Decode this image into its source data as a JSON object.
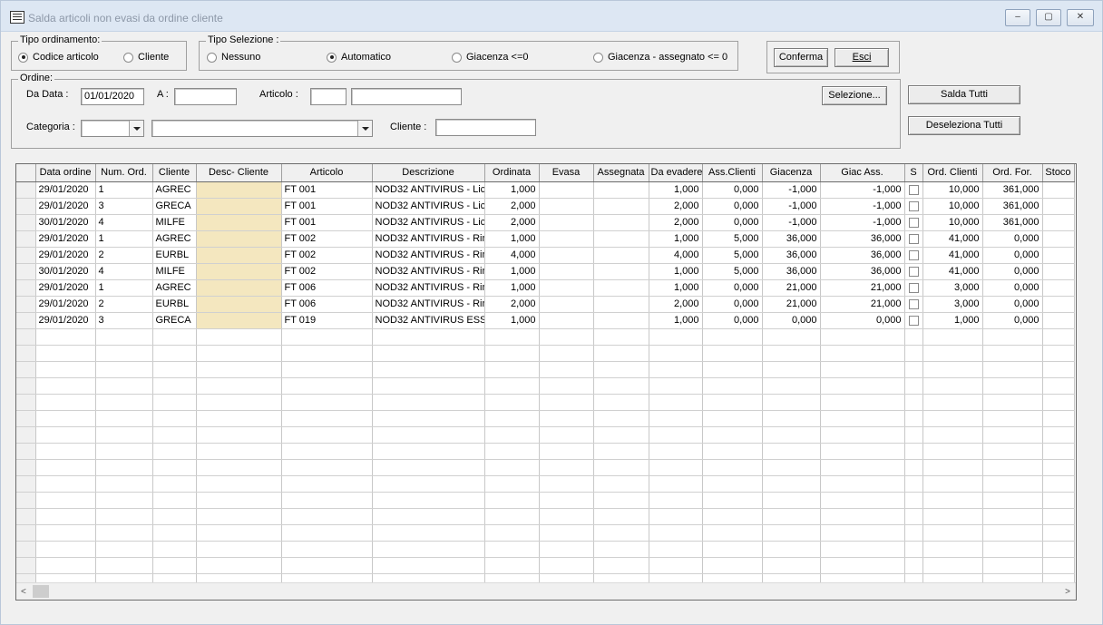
{
  "window": {
    "title": "Salda articoli non evasi da ordine cliente"
  },
  "caption_buttons": {
    "minimize": "‒",
    "maximize": "▢",
    "close": "✕"
  },
  "tipo_ordinamento": {
    "legend": "Tipo ordinamento:",
    "options": [
      "Codice articolo",
      "Cliente"
    ],
    "selected": "Codice articolo"
  },
  "tipo_selezione": {
    "legend": "Tipo Selezione :",
    "options": [
      "Nessuno",
      "Automatico",
      "Giacenza <=0",
      "Giacenza - assegnato <= 0"
    ],
    "selected": "Automatico"
  },
  "actions": {
    "conferma": "Conferma",
    "esci": "Esci"
  },
  "ordine": {
    "legend": "Ordine:",
    "da_data_label": "Da Data :",
    "da_data_value": "01/01/2020",
    "a_label": "A :",
    "a_value": "",
    "articolo_label": "Articolo :",
    "articolo_code": "",
    "articolo_desc": "",
    "categoria_label": "Categoria :",
    "categoria_code": "",
    "categoria_desc": "",
    "cliente_label": "Cliente :",
    "cliente_value": "",
    "selezione_button": "Selezione..."
  },
  "side_buttons": {
    "salda_tutti": "Salda Tutti",
    "deseleziona_tutti": "Deseleziona Tutti"
  },
  "grid": {
    "columns": [
      "Data ordine",
      "Num. Ord.",
      "Cliente",
      "Desc- Cliente",
      "Articolo",
      "Descrizione",
      "Ordinata",
      "Evasa",
      "Assegnata",
      "Da evadere",
      "Ass.Clienti",
      "Giacenza",
      "Giac Ass.",
      "S",
      "Ord. Clienti",
      "Ord. For.",
      "Stoco"
    ],
    "rows": [
      [
        "29/01/2020",
        "1",
        "AGREC",
        "",
        "FT 001",
        "NOD32 ANTIVIRUS - Lic",
        "1,000",
        "",
        "",
        "1,000",
        "0,000",
        "-1,000",
        "-1,000",
        "",
        "10,000",
        "361,000",
        ""
      ],
      [
        "29/01/2020",
        "3",
        "GRECA",
        "",
        "FT 001",
        "NOD32 ANTIVIRUS - Lic",
        "2,000",
        "",
        "",
        "2,000",
        "0,000",
        "-1,000",
        "-1,000",
        "",
        "10,000",
        "361,000",
        ""
      ],
      [
        "30/01/2020",
        "4",
        "MILFE",
        "",
        "FT 001",
        "NOD32 ANTIVIRUS - Lic",
        "2,000",
        "",
        "",
        "2,000",
        "0,000",
        "-1,000",
        "-1,000",
        "",
        "10,000",
        "361,000",
        ""
      ],
      [
        "29/01/2020",
        "1",
        "AGREC",
        "",
        "FT 002",
        "NOD32 ANTIVIRUS - Rin",
        "1,000",
        "",
        "",
        "1,000",
        "5,000",
        "36,000",
        "36,000",
        "",
        "41,000",
        "0,000",
        ""
      ],
      [
        "29/01/2020",
        "2",
        "EURBL",
        "",
        "FT 002",
        "NOD32 ANTIVIRUS - Rin",
        "4,000",
        "",
        "",
        "4,000",
        "5,000",
        "36,000",
        "36,000",
        "",
        "41,000",
        "0,000",
        ""
      ],
      [
        "30/01/2020",
        "4",
        "MILFE",
        "",
        "FT 002",
        "NOD32 ANTIVIRUS - Rin",
        "1,000",
        "",
        "",
        "1,000",
        "5,000",
        "36,000",
        "36,000",
        "",
        "41,000",
        "0,000",
        ""
      ],
      [
        "29/01/2020",
        "1",
        "AGREC",
        "",
        "FT 006",
        "NOD32 ANTIVIRUS - Rin",
        "1,000",
        "",
        "",
        "1,000",
        "0,000",
        "21,000",
        "21,000",
        "",
        "3,000",
        "0,000",
        ""
      ],
      [
        "29/01/2020",
        "2",
        "EURBL",
        "",
        "FT 006",
        "NOD32 ANTIVIRUS - Rin",
        "2,000",
        "",
        "",
        "2,000",
        "0,000",
        "21,000",
        "21,000",
        "",
        "3,000",
        "0,000",
        ""
      ],
      [
        "29/01/2020",
        "3",
        "GRECA",
        "",
        "FT 019",
        "NOD32 ANTIVIRUS ESS",
        "1,000",
        "",
        "",
        "1,000",
        "0,000",
        "0,000",
        "0,000",
        "",
        "1,000",
        "0,000",
        ""
      ]
    ],
    "empty_rows": 16
  },
  "scrollbar": {
    "left_arrow": "<",
    "right_arrow": ">"
  }
}
